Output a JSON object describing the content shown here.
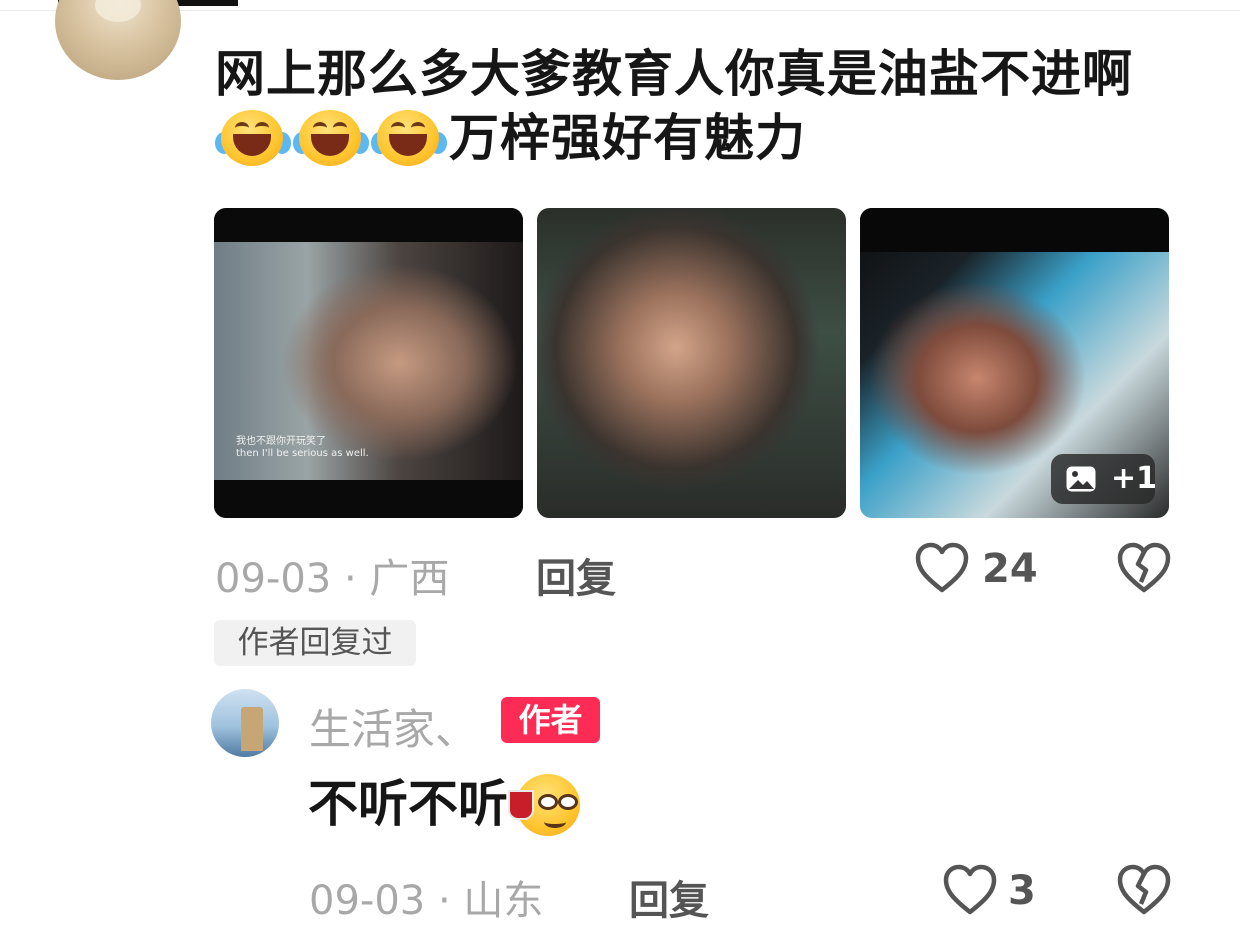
{
  "comment": {
    "text_line1": "网上那么多大爹教育人你真是油盐不进啊",
    "text_line2": "万梓强好有魅力",
    "photos": {
      "subtitle_cn": "我也不跟你开玩笑了",
      "subtitle_en": "then I'll be serious as well.",
      "more_count": "+1"
    },
    "date": "09-03",
    "location": "广西",
    "reply_label": "回复",
    "like_count": "24",
    "author_replied_tag": "作者回复过"
  },
  "reply": {
    "username": "生活家、",
    "author_badge": "作者",
    "text": "不听不听",
    "date": "09-03",
    "location": "山东",
    "reply_label": "回复",
    "like_count": "3"
  },
  "icons": {
    "laugh": "face-with-tears-of-joy-icon",
    "smirk": "smirk-with-drink-icon",
    "like": "heart-outline-icon",
    "dislike": "broken-heart-icon",
    "image": "image-icon"
  },
  "colors": {
    "author_badge_bg": "#fe2c55",
    "meta_text": "#a8a8a8",
    "primary_text": "#161616"
  }
}
